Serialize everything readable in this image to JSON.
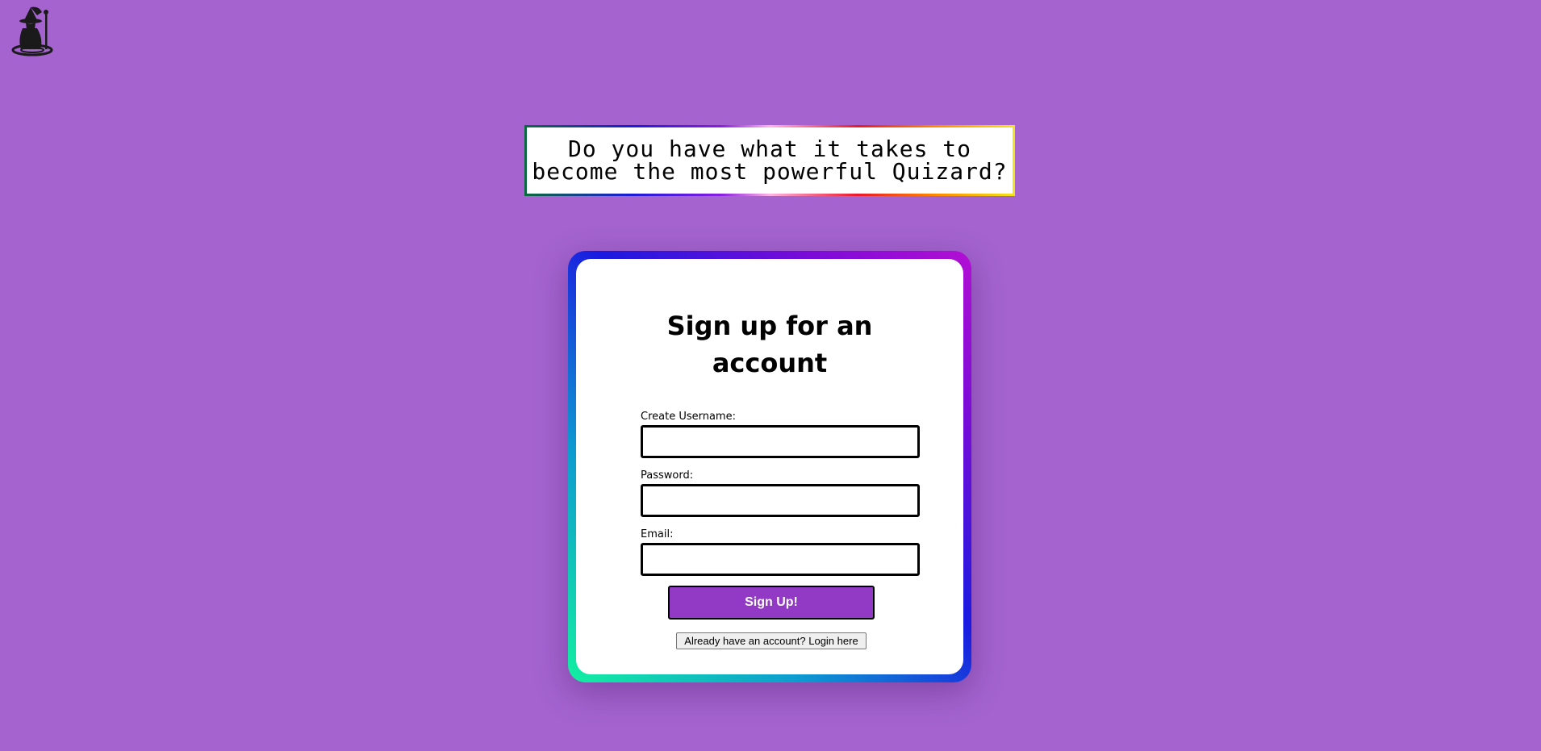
{
  "header": {
    "logo_icon": "wizard-logo-icon"
  },
  "banner": {
    "text": "Do you have what it takes to\nbecome the most powerful Quizard?"
  },
  "signup_form": {
    "title": "Sign up for an account",
    "username_label": "Create Username:",
    "username_value": "",
    "password_label": "Password:",
    "password_value": "",
    "email_label": "Email:",
    "email_value": "",
    "submit_label": "Sign Up!",
    "login_link_label": "Already have an account? Login here"
  },
  "colors": {
    "background": "#a463cf",
    "button": "#9239c6",
    "card": "#ffffff"
  }
}
